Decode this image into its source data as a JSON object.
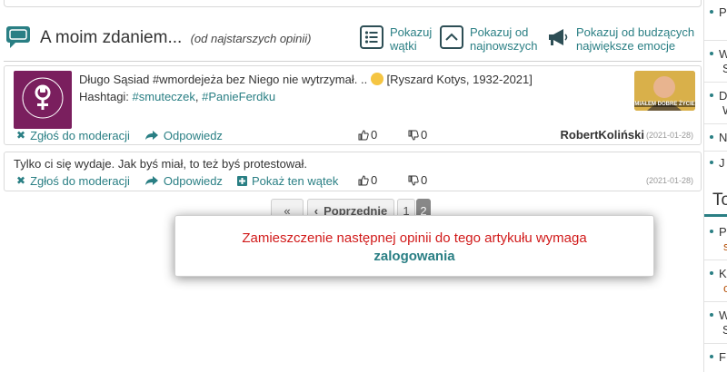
{
  "header": {
    "title": "A moim zdaniem...",
    "subtitle": "(od najstarszych opinii)",
    "btn_threads": [
      "Pokazuj",
      "wątki"
    ],
    "btn_newest": [
      "Pokazuj od",
      "najnowszych"
    ],
    "btn_emotions": [
      "Pokazuj od budzących",
      "największe emocje"
    ]
  },
  "comments": [
    {
      "text": "Długo Sąsiad #wmordejeża bez Niego nie wytrzymał. ..",
      "text_tail": "[Ryszard Kotys, 1932-2021]",
      "hashtags_label": "Hashtagi:",
      "hashtags": [
        "#smuteczek",
        "#PanieFerdku"
      ],
      "thumb_caption": "MIAŁEM DOBRE ŻYCIE",
      "report": "Zgłoś do moderacji",
      "reply": "Odpowiedz",
      "likes": "0",
      "dislikes": "0",
      "author": "RobertKoliński",
      "date": "(2021-01-28)"
    },
    {
      "text": "Tylko ci się wydaje. Jak byś miał, to też byś protestował.",
      "report": "Zgłoś do moderacji",
      "reply": "Odpowiedz",
      "show_thread": "Pokaż ten wątek",
      "likes": "0",
      "dislikes": "0",
      "date": "(2021-01-28)"
    }
  ],
  "pagination": {
    "first": "«",
    "prev": "Poprzednie",
    "pages": [
      "1",
      "2"
    ],
    "current": "2"
  },
  "modal": {
    "message": "Zamieszczenie następnej opinii do tego artykułu wymaga",
    "link": "zalogowania"
  },
  "sidebar": {
    "items": [
      "P",
      "W",
      "S",
      "D",
      "W",
      "N",
      "J"
    ],
    "heading": "To",
    "sub_items": [
      "P",
      "s",
      "K",
      "o",
      "W",
      "S",
      "F"
    ]
  },
  "colors": {
    "accent": "#2a7f84",
    "modal_text": "#d11a1a",
    "avatar_bg": "#7a1f5e",
    "sidebar_sub": "#b6530c"
  }
}
